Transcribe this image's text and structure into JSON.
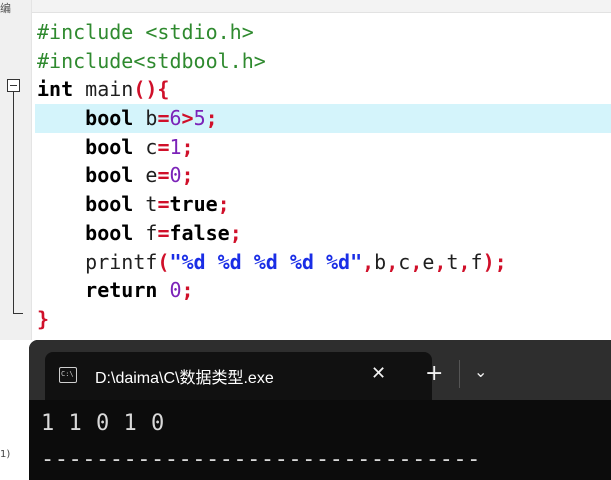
{
  "editor": {
    "gutter_mark": "编",
    "lines": [
      {
        "tokens": [
          {
            "cls": "pp",
            "text": "#include <stdio.h>"
          }
        ]
      },
      {
        "tokens": [
          {
            "cls": "pp",
            "text": "#include<stdbool.h>"
          }
        ]
      },
      {
        "tokens": [
          {
            "cls": "kw",
            "text": "int"
          },
          {
            "cls": "id",
            "text": " main"
          },
          {
            "cls": "br",
            "text": "(){"
          }
        ]
      },
      {
        "highlight": true,
        "tokens": [
          {
            "cls": "id",
            "text": "    "
          },
          {
            "cls": "kw",
            "text": "bool"
          },
          {
            "cls": "id",
            "text": " b"
          },
          {
            "cls": "op",
            "text": "="
          },
          {
            "cls": "num",
            "text": "6"
          },
          {
            "cls": "op",
            "text": ">"
          },
          {
            "cls": "num",
            "text": "5"
          },
          {
            "cls": "op",
            "text": ";"
          }
        ]
      },
      {
        "tokens": [
          {
            "cls": "id",
            "text": "    "
          },
          {
            "cls": "kw",
            "text": "bool"
          },
          {
            "cls": "id",
            "text": " c"
          },
          {
            "cls": "op",
            "text": "="
          },
          {
            "cls": "num",
            "text": "1"
          },
          {
            "cls": "op",
            "text": ";"
          }
        ]
      },
      {
        "tokens": [
          {
            "cls": "id",
            "text": "    "
          },
          {
            "cls": "kw",
            "text": "bool"
          },
          {
            "cls": "id",
            "text": " e"
          },
          {
            "cls": "op",
            "text": "="
          },
          {
            "cls": "num",
            "text": "0"
          },
          {
            "cls": "op",
            "text": ";"
          }
        ]
      },
      {
        "tokens": [
          {
            "cls": "id",
            "text": "    "
          },
          {
            "cls": "kw",
            "text": "bool"
          },
          {
            "cls": "id",
            "text": " t"
          },
          {
            "cls": "op",
            "text": "="
          },
          {
            "cls": "kw",
            "text": "true"
          },
          {
            "cls": "op",
            "text": ";"
          }
        ]
      },
      {
        "tokens": [
          {
            "cls": "id",
            "text": "    "
          },
          {
            "cls": "kw",
            "text": "bool"
          },
          {
            "cls": "id",
            "text": " f"
          },
          {
            "cls": "op",
            "text": "="
          },
          {
            "cls": "kw",
            "text": "false"
          },
          {
            "cls": "op",
            "text": ";"
          }
        ]
      },
      {
        "tokens": [
          {
            "cls": "id",
            "text": "    printf"
          },
          {
            "cls": "br",
            "text": "("
          },
          {
            "cls": "str",
            "text": "\"%d %d %d %d %d\""
          },
          {
            "cls": "op",
            "text": ","
          },
          {
            "cls": "id",
            "text": "b"
          },
          {
            "cls": "op",
            "text": ","
          },
          {
            "cls": "id",
            "text": "c"
          },
          {
            "cls": "op",
            "text": ","
          },
          {
            "cls": "id",
            "text": "e"
          },
          {
            "cls": "op",
            "text": ","
          },
          {
            "cls": "id",
            "text": "t"
          },
          {
            "cls": "op",
            "text": ","
          },
          {
            "cls": "id",
            "text": "f"
          },
          {
            "cls": "br",
            "text": ")"
          },
          {
            "cls": "op",
            "text": ";"
          }
        ]
      },
      {
        "tokens": [
          {
            "cls": "id",
            "text": "    "
          },
          {
            "cls": "kw",
            "text": "return"
          },
          {
            "cls": "id",
            "text": " "
          },
          {
            "cls": "num",
            "text": "0"
          },
          {
            "cls": "op",
            "text": ";"
          }
        ]
      },
      {
        "tokens": [
          {
            "cls": "br",
            "text": "}"
          }
        ]
      }
    ]
  },
  "terminal": {
    "tab_icon_text": "C:\\",
    "tab_title": "D:\\daima\\C\\数据类型.exe",
    "close_glyph": "✕",
    "new_tab_glyph": "+",
    "dropdown_glyph": "⌄",
    "output": "1 1 0 1 0",
    "divider": "--------------------------------"
  },
  "edge_label": "1)",
  "colors": {
    "preprocessor": "#2f8a2f",
    "keyword": "#000000",
    "operator": "#d0102a",
    "number": "#7b22b8",
    "string": "#1a2ee6",
    "highlight_line": "#d4f4fb",
    "terminal_bg": "#0c0c0c",
    "tab_bar_bg": "#2e2e2e"
  },
  "icons": [
    "fold-collapse-icon",
    "terminal-app-icon",
    "close-icon",
    "plus-icon",
    "chevron-down-icon"
  ]
}
